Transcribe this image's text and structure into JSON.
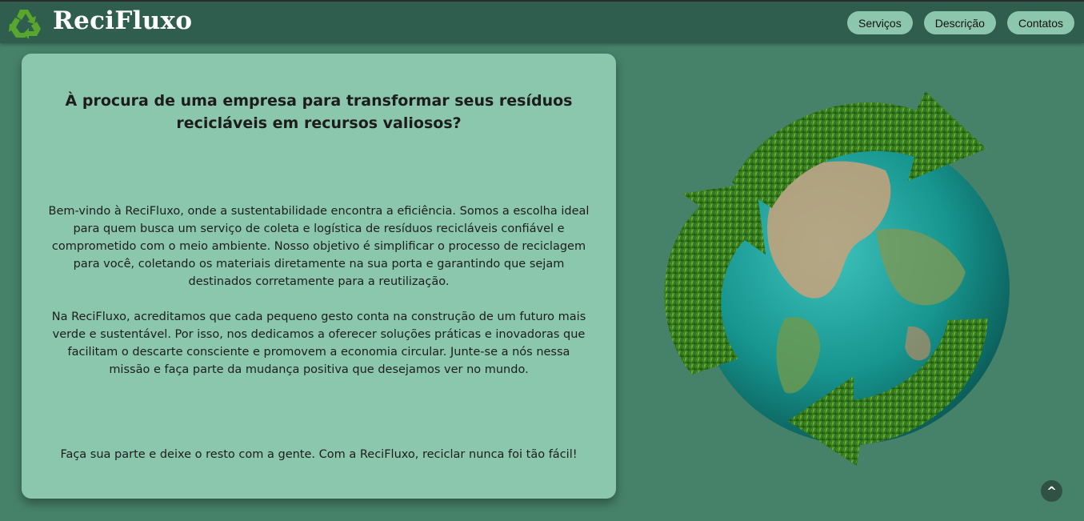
{
  "header": {
    "brand": "ReciFluxo",
    "logo_icon": "recycle-icon",
    "nav": [
      {
        "label": "Serviços"
      },
      {
        "label": "Descrição"
      },
      {
        "label": "Contatos"
      }
    ]
  },
  "main": {
    "heading": "À procura de uma empresa para transformar seus resíduos recicláveis em recursos valiosos?",
    "paragraph_1": "Bem-vindo à ReciFluxo, onde a sustentabilidade encontra a eficiência. Somos a escolha ideal para quem busca um serviço de coleta e logística de resíduos recicláveis confiável e comprometido com o meio ambiente. Nosso objetivo é simplificar o processo de reciclagem para você, coletando os materiais diretamente na sua porta e garantindo que sejam destinados corretamente para a reutilização.",
    "paragraph_2": "Na ReciFluxo, acreditamos que cada pequeno gesto conta na construção de um futuro mais verde e sustentável. Por isso, nos dedicamos a oferecer soluções práticas e inovadoras que facilitam o descarte consciente e promovem a economia circular. Junte-se a nós nessa missão e faça parte da mudança positiva que desejamos ver no mundo.",
    "tagline": "Faça sua parte e deixe o resto com a gente. Com a ReciFluxo, reciclar nunca foi tão fácil!"
  },
  "illustration": {
    "icon": "globe-recycle-arrows-image"
  },
  "scroll_top": {
    "label": "^",
    "icon": "caret-up-icon"
  },
  "colors": {
    "page_background": "#46826a",
    "navbar": "#2f5e4f",
    "card": "#8bc7ad",
    "nav_button": "#8cc7ad",
    "logo_green": "#5aa82f"
  }
}
